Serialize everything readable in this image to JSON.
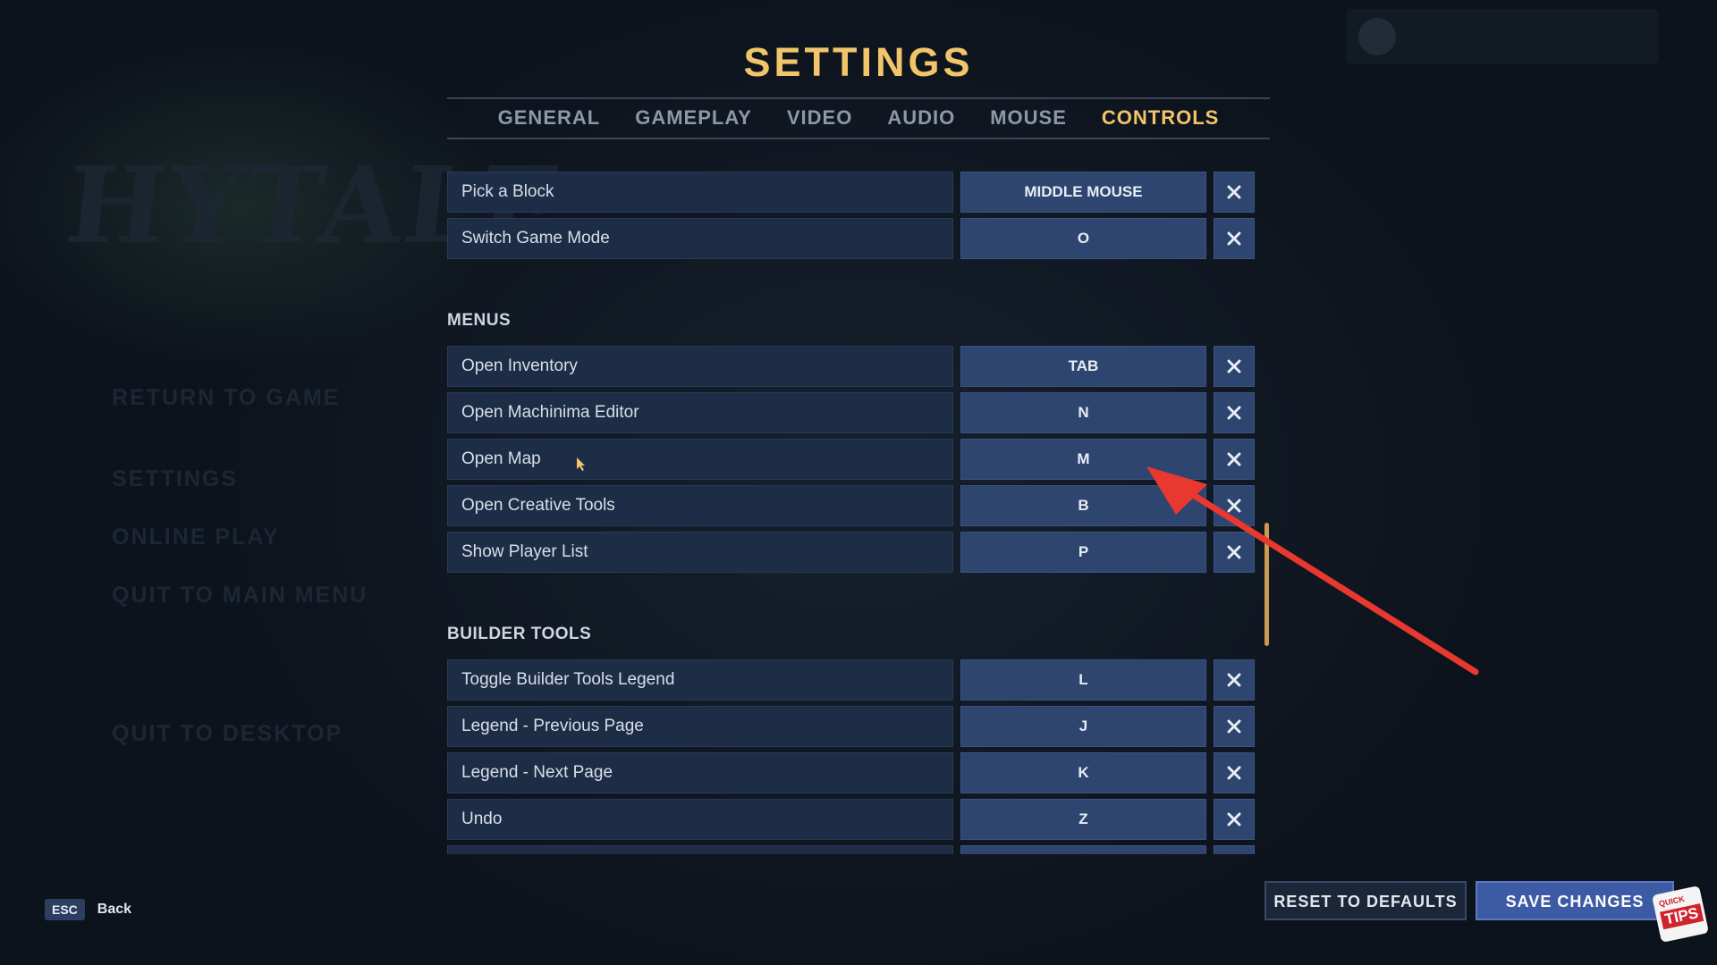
{
  "background_menu": {
    "logo": "HYTALE",
    "items": [
      "RETURN TO GAME",
      "SETTINGS",
      "ONLINE PLAY",
      "QUIT TO MAIN MENU",
      "QUIT TO DESKTOP"
    ]
  },
  "header": {
    "title": "SETTINGS"
  },
  "tabs": [
    {
      "label": "GENERAL",
      "active": false
    },
    {
      "label": "GAMEPLAY",
      "active": false
    },
    {
      "label": "VIDEO",
      "active": false
    },
    {
      "label": "AUDIO",
      "active": false
    },
    {
      "label": "MOUSE",
      "active": false
    },
    {
      "label": "CONTROLS",
      "active": true
    }
  ],
  "bindings": {
    "top": [
      {
        "action": "Pick a Block",
        "key": "MIDDLE MOUSE"
      },
      {
        "action": "Switch Game Mode",
        "key": "O"
      }
    ],
    "menus": {
      "title": "MENUS",
      "rows": [
        {
          "action": "Open Inventory",
          "key": "TAB"
        },
        {
          "action": "Open Machinima Editor",
          "key": "N"
        },
        {
          "action": "Open Map",
          "key": "M"
        },
        {
          "action": "Open Creative Tools",
          "key": "B"
        },
        {
          "action": "Show Player List",
          "key": "P"
        }
      ]
    },
    "builder_tools": {
      "title": "BUILDER TOOLS",
      "rows": [
        {
          "action": "Toggle Builder Tools Legend",
          "key": "L"
        },
        {
          "action": "Legend - Previous Page",
          "key": "J"
        },
        {
          "action": "Legend - Next Page",
          "key": "K"
        },
        {
          "action": "Undo",
          "key": "Z"
        },
        {
          "action": "",
          "key": ""
        }
      ]
    }
  },
  "footer": {
    "esc_key": "ESC",
    "back_label": "Back",
    "reset_label": "RESET TO DEFAULTS",
    "save_label": "SAVE CHANGES"
  },
  "overlay": {
    "arrow_color": "#e8382f",
    "badge_top": "QUICK",
    "badge_bottom": "TIPS"
  },
  "colors": {
    "accent": "#f2c56a",
    "key_button": "#2e4570",
    "row_background": "#1d2d46",
    "save_button": "#3d5aa4"
  },
  "icons": {
    "clear": "close-icon",
    "cursor": "mouse-cursor-icon"
  }
}
